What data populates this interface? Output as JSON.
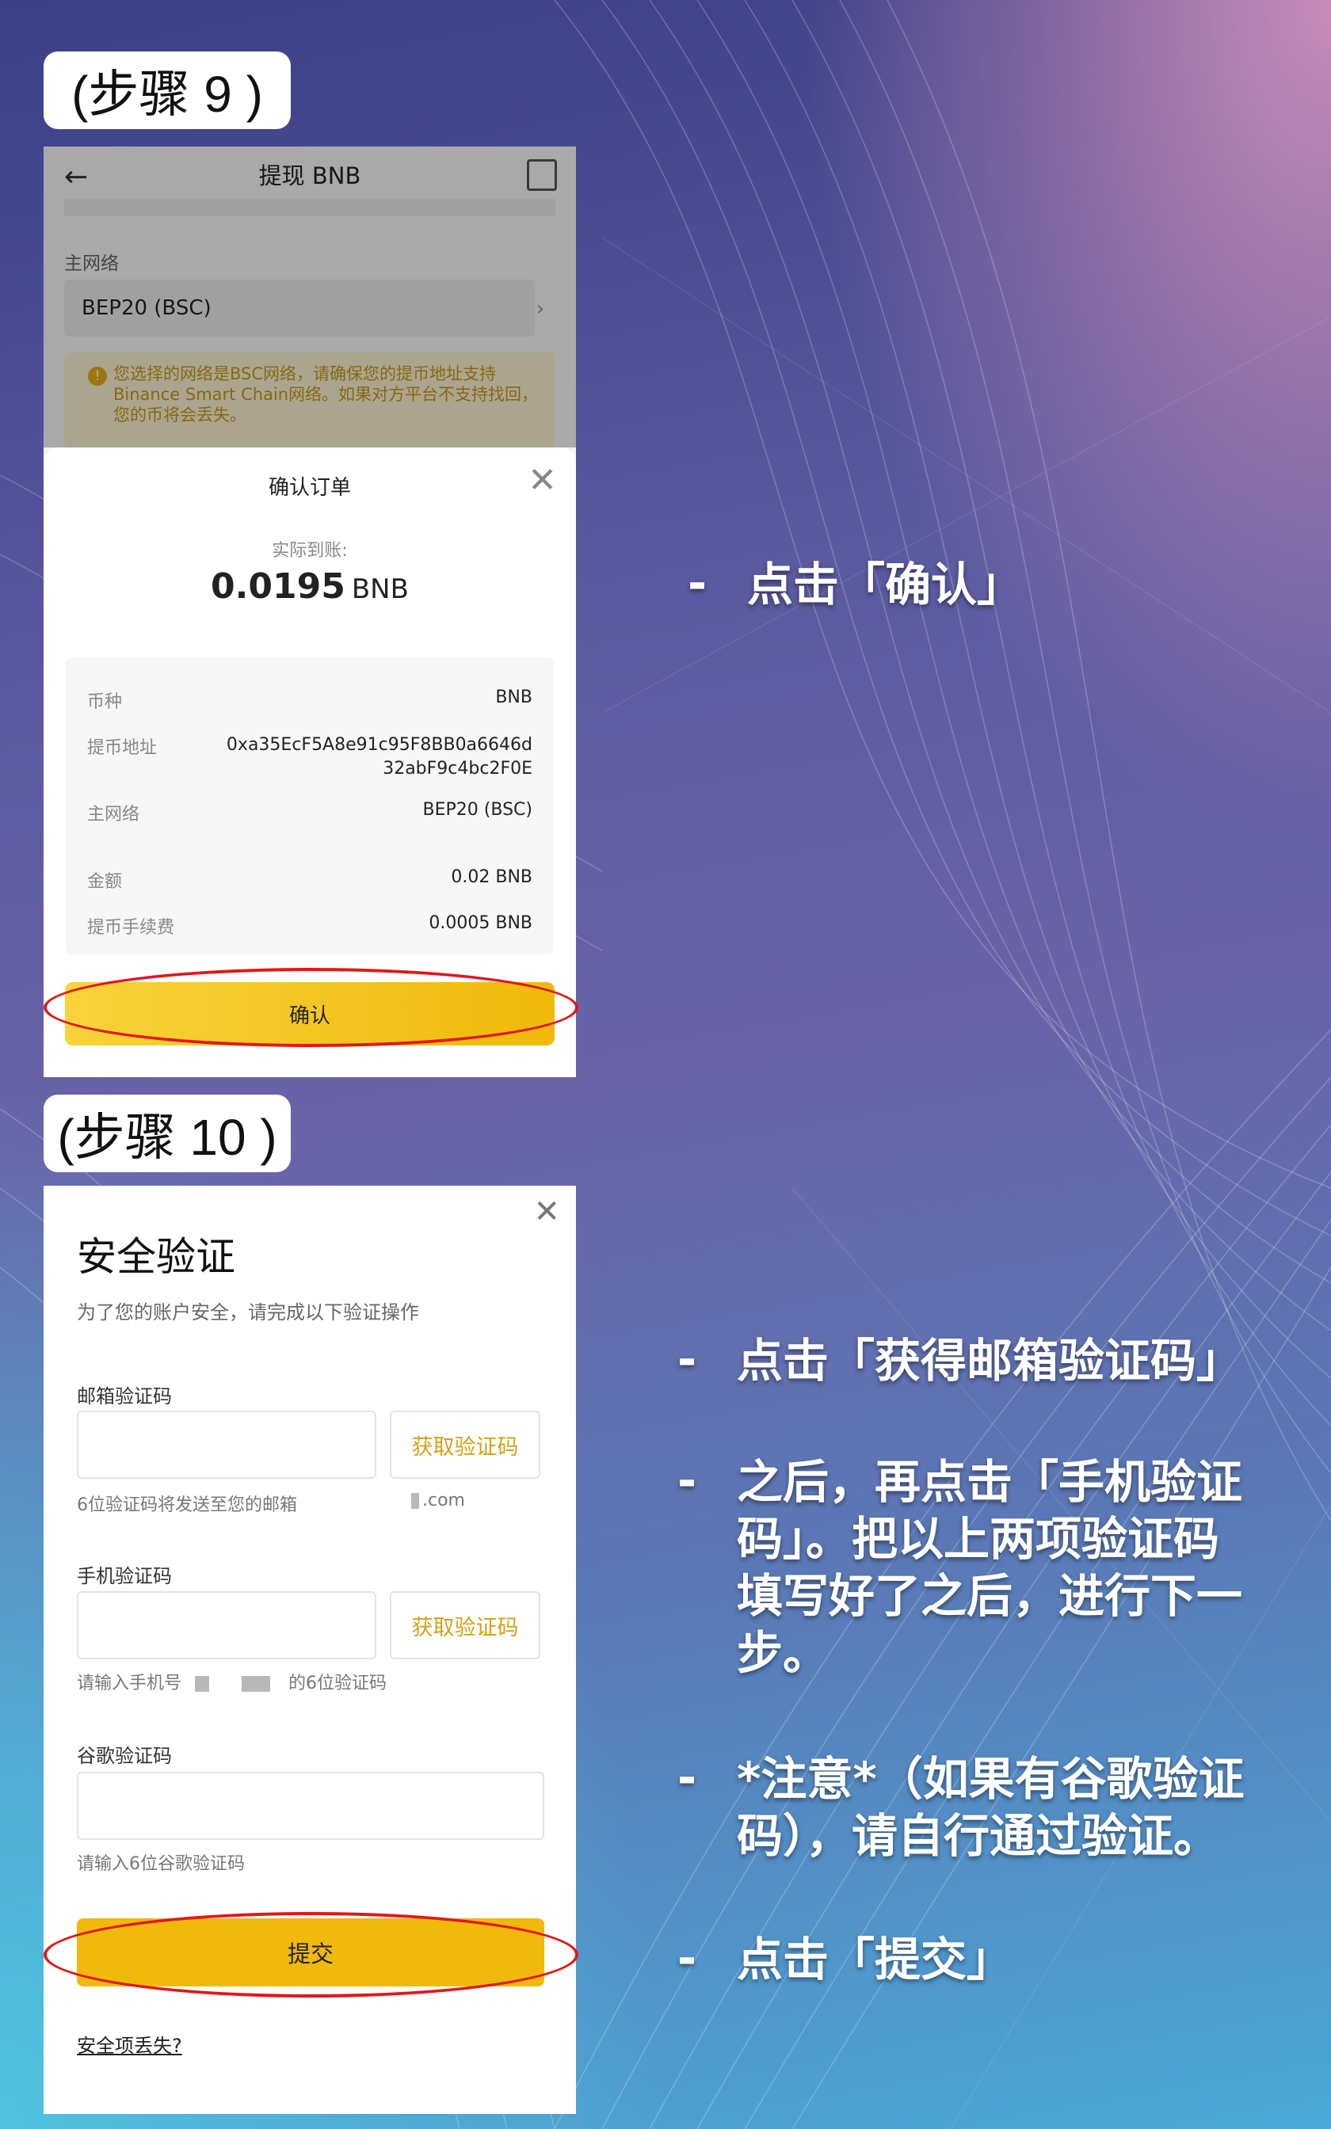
{
  "step9": {
    "tag": "(步骤 9 )",
    "header_title": "提现 BNB",
    "network_label": "主网络",
    "network_value": "BEP20 (BSC)",
    "warning_text": "您选择的网络是BSC网络，请确保您的提币地址支持Binance Smart Chain网络。如果对方平台不支持找回，您的币将会丢失。",
    "sheet": {
      "title": "确认订单",
      "received_label": "实际到账:",
      "received_amount": "0.0195",
      "received_unit": "BNB",
      "rows": [
        {
          "key": "币种",
          "value": "BNB"
        },
        {
          "key": "提币地址",
          "value": "0xa35EcF5A8e91c95F8BB0a6646d\n32abF9c4bc2F0E"
        },
        {
          "key": "主网络",
          "value": "BEP20 (BSC)"
        },
        {
          "key": "金额",
          "value": "0.02 BNB"
        },
        {
          "key": "提币手续费",
          "value": "0.0005 BNB"
        }
      ],
      "confirm_label": "确认"
    }
  },
  "step10": {
    "tag": "(步骤 10 )",
    "title": "安全验证",
    "subtitle": "为了您的账户安全，请完成以下验证操作",
    "email_label": "邮箱验证码",
    "email_get_code": "获取验证码",
    "email_hint": "6位验证码将发送至您的邮箱",
    "email_domain": ".com",
    "phone_label": "手机验证码",
    "phone_get_code": "获取验证码",
    "phone_hint_prefix": "请输入手机号",
    "phone_hint_suffix": "的6位验证码",
    "google_label": "谷歌验证码",
    "google_hint": "请输入6位谷歌验证码",
    "submit_label": "提交",
    "lost_link": "安全项丢失?"
  },
  "instructions": [
    {
      "dash": "-",
      "text": "点击「确认」"
    },
    {
      "dash": "-",
      "text": "点击「获得邮箱验证码」"
    },
    {
      "dash": "-",
      "text": "之后，再点击「手机验证\n码」。把以上两项验证码\n填写好了之后，进行下一\n步。"
    },
    {
      "dash": "-",
      "text": "*注意*（如果有谷歌验证\n码），请自行通过验证。"
    },
    {
      "dash": "-",
      "text": "点击「提交」"
    }
  ],
  "colors": {
    "accent_yellow": "#f0b90b",
    "highlight_red": "#e11818",
    "link_gold": "#d6a117"
  }
}
